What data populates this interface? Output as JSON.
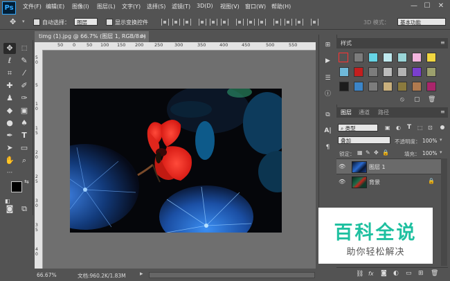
{
  "app": {
    "logo": "Ps"
  },
  "menu": [
    "文件(F)",
    "编辑(E)",
    "图像(I)",
    "图层(L)",
    "文字(Y)",
    "选择(S)",
    "滤镜(T)",
    "3D(D)",
    "视图(V)",
    "窗口(W)",
    "帮助(H)"
  ],
  "window_controls": {
    "minimize": "—",
    "maximize": "☐",
    "close": "✕"
  },
  "options": {
    "auto_select_label": "自动选择：",
    "auto_select_value": "图层",
    "show_transform_label": "显示变换控件",
    "mode_3d_label": "3D 模式：",
    "workspace": "基本功能"
  },
  "document": {
    "tab_title": "timg (1).jpg @ 66.7% (图层 1, RGB/8#) *",
    "close_glyph": "×",
    "ruler_top": [
      "50",
      "0",
      "50",
      "100",
      "150",
      "200",
      "250",
      "300",
      "350",
      "400",
      "450",
      "500",
      "550"
    ],
    "ruler_left": [
      "5",
      "0",
      "5",
      "1",
      "0",
      "1",
      "5",
      "2",
      "0",
      "2",
      "5",
      "3",
      "0",
      "3",
      "5",
      "4",
      "0"
    ],
    "zoom": "66.67%",
    "doc_size": "文档:960.2K/1.83M"
  },
  "styles_panel": {
    "tab": "样式",
    "swatch_colors": [
      "#e8e8e8",
      "#7c7c7c",
      "#66d4e6",
      "#bfe9ef",
      "#9ad5d8",
      "#f3b5de",
      "#f1d640",
      "#6fb9d9",
      "#c31e1e",
      "#7c7c7c",
      "#bcbcbc",
      "#b3b3b3",
      "#7a3fcf",
      "#9ca06d",
      "#1c1c1c",
      "#3c85c8",
      "#7c7c7c",
      "#c9b07d",
      "#8a7a3e",
      "#b07a4f",
      "#a9256b"
    ]
  },
  "layers_panel": {
    "tabs": [
      "图层",
      "通道",
      "路径"
    ],
    "filter_label": "类型",
    "blend_mode": "叠加",
    "opacity_label": "不透明度：",
    "opacity_value": "100%",
    "lock_label": "锁定：",
    "fill_label": "填充：",
    "fill_value": "100%",
    "layers": [
      {
        "name": "图层 1",
        "selected": true
      },
      {
        "name": "背景",
        "selected": false
      }
    ],
    "footer_icons": [
      "link-icon",
      "fx-icon",
      "mask-icon",
      "adjustment-icon",
      "folder-icon",
      "new-layer-icon",
      "trash-icon"
    ],
    "fx_label": "fx"
  },
  "watermark": {
    "title": "百科全说",
    "subtitle": "助你轻松解决"
  },
  "colors": {
    "accent": "#31a8ff",
    "watermark_green": "#1fc0a0",
    "panel_bg": "#535353"
  }
}
